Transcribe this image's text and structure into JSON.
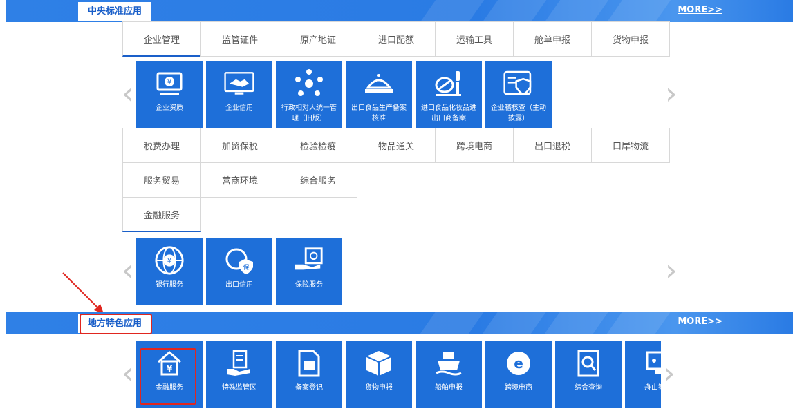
{
  "section1": {
    "title": "中央标准应用",
    "more": "MORE>>",
    "tabs_row1": [
      "企业管理",
      "监管证件",
      "原产地证",
      "进口配额",
      "运输工具",
      "舱单申报",
      "货物申报"
    ],
    "tiles1": [
      {
        "label": "企业资质",
        "icon": "monitor-certificate-icon"
      },
      {
        "label": "企业信用",
        "icon": "handshake-icon"
      },
      {
        "label": "行政相对人统一管理（旧版）",
        "icon": "people-network-icon"
      },
      {
        "label": "出口食品生产备案核准",
        "icon": "food-dish-icon"
      },
      {
        "label": "进口食品化妆品进出口商备案",
        "icon": "cosmetics-icon"
      },
      {
        "label": "企业稽核查（主动披露）",
        "icon": "document-shield-icon"
      }
    ],
    "tabs_row2": [
      "税费办理",
      "加贸保税",
      "检验检疫",
      "物品通关",
      "跨境电商",
      "出口退税",
      "口岸物流"
    ],
    "tabs_row3": [
      "服务贸易",
      "营商环境",
      "综合服务"
    ],
    "tabs_row4": [
      "金融服务"
    ],
    "tiles2": [
      {
        "label": "银行服务",
        "icon": "globe-yuan-icon"
      },
      {
        "label": "出口信用",
        "icon": "globe-shield-icon"
      },
      {
        "label": "保险服务",
        "icon": "safe-hand-icon"
      }
    ]
  },
  "section2": {
    "title": "地方特色应用",
    "more": "MORE>>",
    "tiles": [
      {
        "label": "金融服务",
        "icon": "house-yuan-icon"
      },
      {
        "label": "特殊监管区",
        "icon": "hand-document-icon"
      },
      {
        "label": "备案登记",
        "icon": "form-document-icon"
      },
      {
        "label": "货物申报",
        "icon": "cargo-box-icon"
      },
      {
        "label": "船舶申报",
        "icon": "ship-icon"
      },
      {
        "label": "跨境电商",
        "icon": "ecommerce-e-icon"
      },
      {
        "label": "综合查询",
        "icon": "search-document-icon"
      },
      {
        "label": "舟山智慧",
        "icon": "screen-icon"
      }
    ]
  },
  "colors": {
    "primary": "#1e6fd9",
    "annotation": "#e0261f",
    "tab_border": "#d8d8d8"
  }
}
